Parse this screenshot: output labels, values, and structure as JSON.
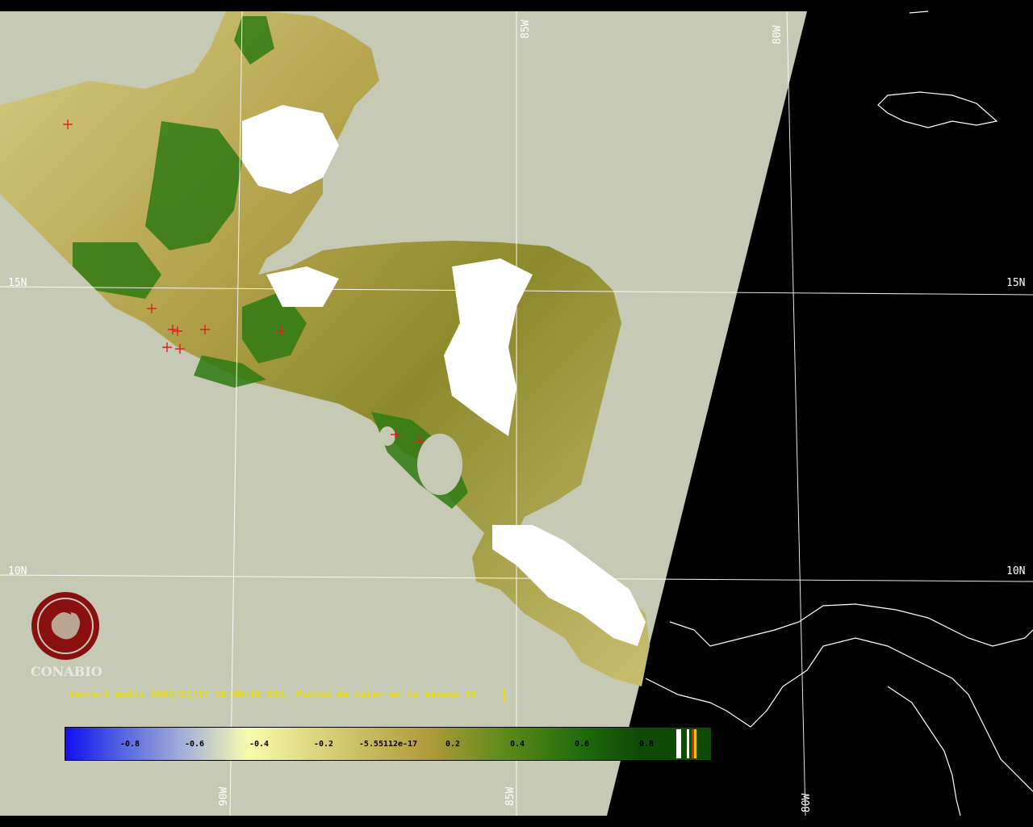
{
  "graticule": {
    "lat_labels": [
      "15N",
      "10N"
    ],
    "lon_labels": [
      "85W",
      "80W",
      "90W"
    ]
  },
  "logo": {
    "name": "CONABIO"
  },
  "caption": "terra-1 modis 2007/11/17 16:40:58 EVI, Puntos de calor en la escena 13",
  "colorbar": {
    "ticks": [
      "-0.8",
      "-0.6",
      "-0.4",
      "-0.2",
      "-5.55112e-17",
      "0.2",
      "0.4",
      "0.6",
      "0.8"
    ],
    "colors": [
      "#1010f0",
      "#8a96d8",
      "#f4f8a8",
      "#d8cc70",
      "#b09a3a",
      "#5a8a1a",
      "#1f6a0c",
      "#0f4a06"
    ]
  },
  "hotspots_label": "Puntos de calor",
  "colors": {
    "ocean": "#c6cab4",
    "night": "#000000",
    "vegetation_dark": "#2f7a12",
    "vegetation_mid": "#b3a24a",
    "cloud": "#ffffff",
    "hotspot": "#e02020",
    "caption": "#e8e000"
  }
}
